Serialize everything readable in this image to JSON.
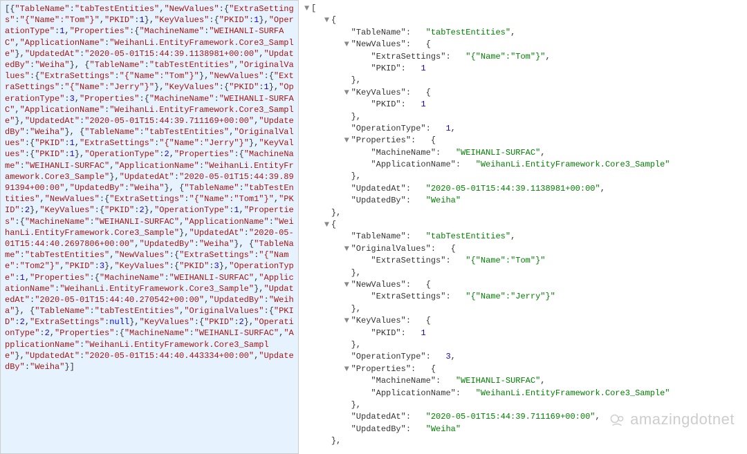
{
  "watermark_text": "amazingdotnet",
  "raw_json": [
    {
      "TableName": "tabTestEntities",
      "NewValues": {
        "ExtraSettings": "{\"Name\":\"Tom\"}",
        "PKID": 1
      },
      "KeyValues": {
        "PKID": 1
      },
      "OperationType": 1,
      "Properties": {
        "MachineName": "WEIHANLI-SURFAC",
        "ApplicationName": "WeihanLi.EntityFramework.Core3_Sample"
      },
      "UpdatedAt": "2020-05-01T15:44:39.1138981+00:00",
      "UpdatedBy": "Weiha"
    },
    {
      "TableName": "tabTestEntities",
      "OriginalValues": {
        "ExtraSettings": "{\"Name\":\"Tom\"}"
      },
      "NewValues": {
        "ExtraSettings": "{\"Name\":\"Jerry\"}"
      },
      "KeyValues": {
        "PKID": 1
      },
      "OperationType": 3,
      "Properties": {
        "MachineName": "WEIHANLI-SURFAC",
        "ApplicationName": "WeihanLi.EntityFramework.Core3_Sample"
      },
      "UpdatedAt": "2020-05-01T15:44:39.711169+00:00",
      "UpdatedBy": "Weiha"
    },
    {
      "TableName": "tabTestEntities",
      "OriginalValues": {
        "PKID": 1,
        "ExtraSettings": "{\"Name\":\"Jerry\"}"
      },
      "KeyValues": {
        "PKID": 1
      },
      "OperationType": 2,
      "Properties": {
        "MachineName": "WEIHANLI-SURFAC",
        "ApplicationName": "WeihanLi.EntityFramework.Core3_Sample"
      },
      "UpdatedAt": "2020-05-01T15:44:39.8991394+00:00",
      "UpdatedBy": "Weiha"
    },
    {
      "TableName": "tabTestEntities",
      "NewValues": {
        "ExtraSettings": "{\"Name\":\"Tom1\"}",
        "PKID": 2
      },
      "KeyValues": {
        "PKID": 2
      },
      "OperationType": 1,
      "Properties": {
        "MachineName": "WEIHANLI-SURFAC",
        "ApplicationName": "WeihanLi.EntityFramework.Core3_Sample"
      },
      "UpdatedAt": "2020-05-01T15:44:40.2697806+00:00",
      "UpdatedBy": "Weiha"
    },
    {
      "TableName": "tabTestEntities",
      "NewValues": {
        "ExtraSettings": "{\"Name\":\"Tom2\"}",
        "PKID": 3
      },
      "KeyValues": {
        "PKID": 3
      },
      "OperationType": 1,
      "Properties": {
        "MachineName": "WEIHANLI-SURFAC",
        "ApplicationName": "WeihanLi.EntityFramework.Core3_Sample"
      },
      "UpdatedAt": "2020-05-01T15:44:40.270542+00:00",
      "UpdatedBy": "Weiha"
    },
    {
      "TableName": "tabTestEntities",
      "OriginalValues": {
        "PKID": 2,
        "ExtraSettings": null
      },
      "KeyValues": {
        "PKID": 2
      },
      "OperationType": 2,
      "Properties": {
        "MachineName": "WEIHANLI-SURFAC",
        "ApplicationName": "WeihanLi.EntityFramework.Core3_Sample"
      },
      "UpdatedAt": "2020-05-01T15:44:40.443334+00:00",
      "UpdatedBy": "Weiha"
    }
  ],
  "tree_view": {
    "expanded_indices": [
      0,
      1
    ],
    "format": "expanded-json-pretty"
  }
}
